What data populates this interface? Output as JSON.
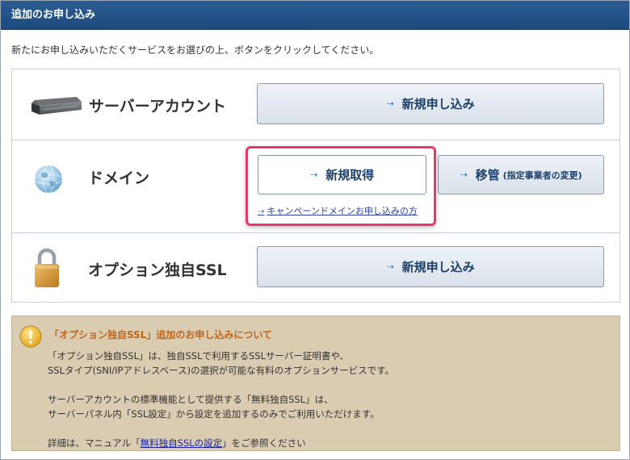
{
  "header": {
    "title": "追加のお申し込み"
  },
  "intro": "新たにお申し込みいただくサービスをお選びの上、ボタンをクリックしてください。",
  "services": [
    {
      "label": "サーバーアカウント",
      "icon": "server-icon",
      "button": "新規申し込み"
    },
    {
      "label": "ドメイン",
      "icon": "globe-icon",
      "button_primary": "新規取得",
      "button_secondary": "移管",
      "button_secondary_note": "(指定事業者の変更)",
      "campaign_link": "キャンペーンドメインお申し込みの方"
    },
    {
      "label": "オプション独自SSL",
      "icon": "padlock-icon",
      "button": "新規申し込み"
    }
  ],
  "notice": {
    "icon": "warning-icon",
    "title": "「オプション独自SSL」追加のお申し込みについて",
    "line1": "「オプション独自SSL」は、独自SSLで利用するSSLサーバー証明書や、",
    "line2": "SSLタイプ(SNI/IPアドレスベース)の選択が可能な有料のオプションサービスです。",
    "line3": "サーバーアカウントの標準機能として提供する「無料独自SSL」は、",
    "line4": "サーバーパネル内「SSL設定」から設定を追加するのみでご利用いただけます。",
    "line5_prefix": "詳細は、マニュアル「",
    "line5_link": "無料独自SSLの設定",
    "line5_suffix": "」をご参照ください"
  },
  "colors": {
    "header_bg": "#1d4a7d",
    "highlight": "#e8386e",
    "notice_bg": "#d9ccb1",
    "notice_title": "#c0661a"
  }
}
